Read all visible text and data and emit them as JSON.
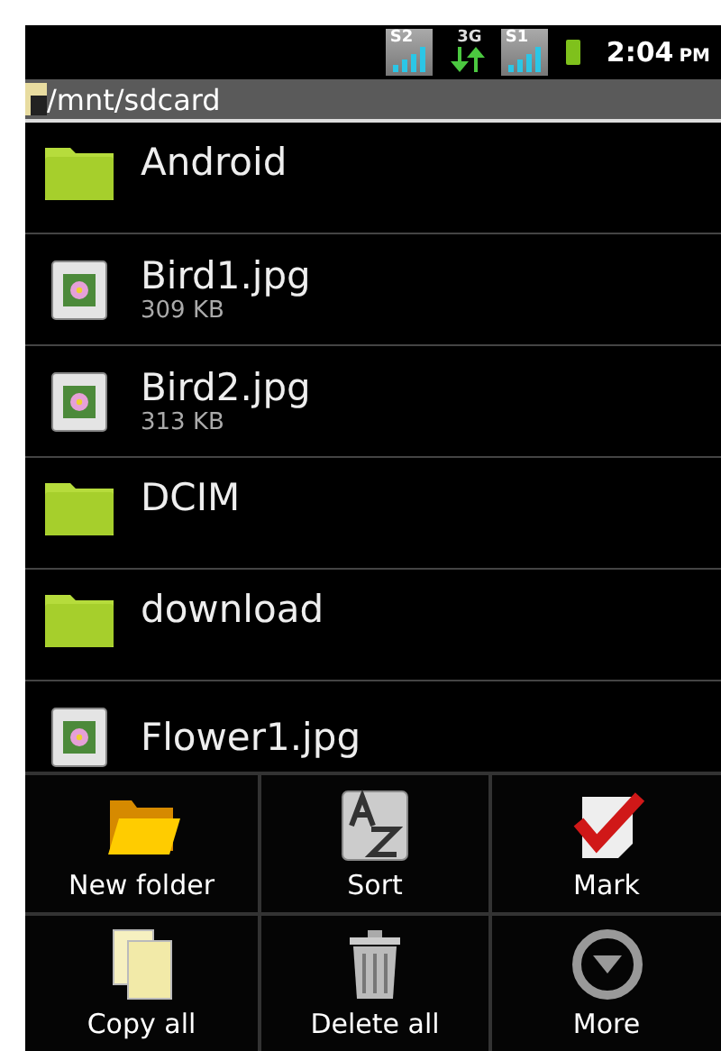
{
  "status_bar": {
    "indicators": [
      {
        "kind": "signal",
        "label": "S2"
      },
      {
        "kind": "data",
        "label": "3G"
      },
      {
        "kind": "signal",
        "label": "S1"
      }
    ],
    "time": "2:04",
    "meridiem": "PM"
  },
  "path_bar": {
    "path": "/mnt/sdcard"
  },
  "files": [
    {
      "kind": "folder",
      "name": "Android"
    },
    {
      "kind": "image",
      "name": "Bird1.jpg",
      "size": "309 KB"
    },
    {
      "kind": "image",
      "name": "Bird2.jpg",
      "size": "313 KB"
    },
    {
      "kind": "folder",
      "name": "DCIM"
    },
    {
      "kind": "folder",
      "name": "download"
    },
    {
      "kind": "image",
      "name": "Flower1.jpg"
    }
  ],
  "menu": [
    {
      "kind": "new-folder",
      "label": "New folder"
    },
    {
      "kind": "sort",
      "label": "Sort"
    },
    {
      "kind": "mark",
      "label": "Mark"
    },
    {
      "kind": "copy",
      "label": "Copy all"
    },
    {
      "kind": "delete",
      "label": "Delete all"
    },
    {
      "kind": "more",
      "label": "More"
    }
  ]
}
